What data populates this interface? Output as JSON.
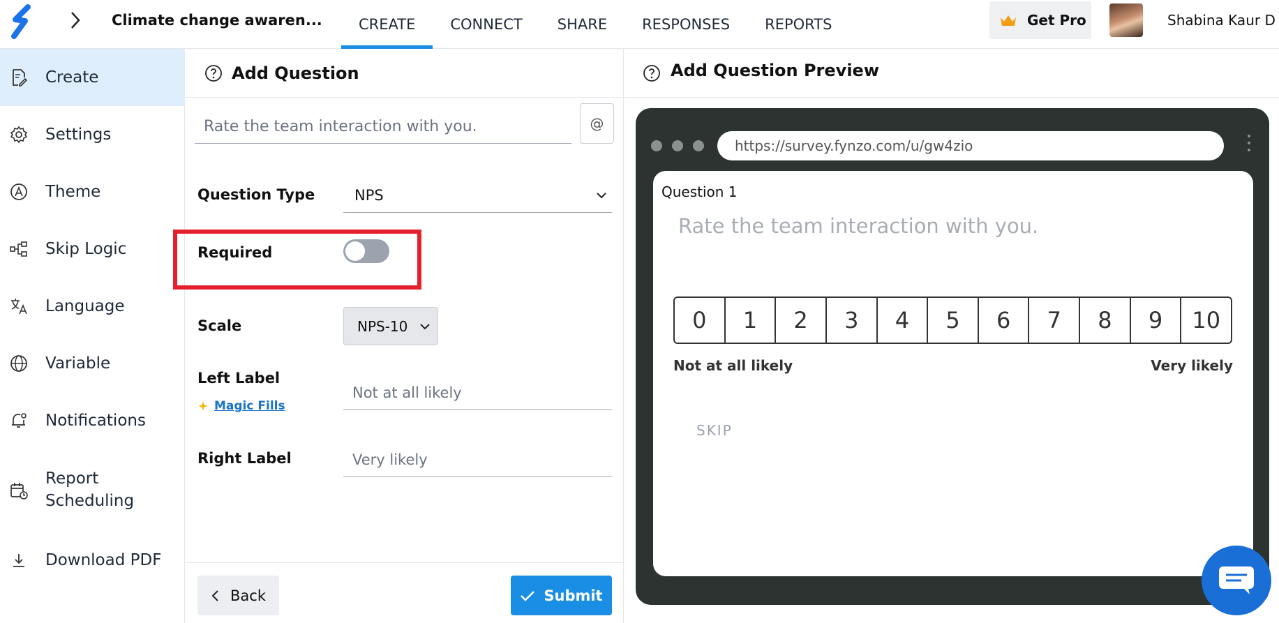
{
  "header": {
    "survey_title": "Climate change awaren...",
    "tabs": [
      {
        "label": "CREATE",
        "active": true
      },
      {
        "label": "CONNECT",
        "active": false
      },
      {
        "label": "SHARE",
        "active": false
      },
      {
        "label": "RESPONSES",
        "active": false
      },
      {
        "label": "REPORTS",
        "active": false
      }
    ],
    "get_pro_label": "Get Pro",
    "user_name": "Shabina Kaur D"
  },
  "sidebar": {
    "items": [
      {
        "label": "Create",
        "icon": "edit-document-icon",
        "active": true
      },
      {
        "label": "Settings",
        "icon": "gear-icon"
      },
      {
        "label": "Theme",
        "icon": "palette-icon"
      },
      {
        "label": "Skip Logic",
        "icon": "flow-icon"
      },
      {
        "label": "Language",
        "icon": "translate-icon"
      },
      {
        "label": "Variable",
        "icon": "globe-icon"
      },
      {
        "label": "Notifications",
        "icon": "bell-icon"
      },
      {
        "label": "Report Scheduling",
        "icon": "calendar-clock-icon"
      },
      {
        "label": "Download PDF",
        "icon": "download-icon"
      }
    ]
  },
  "editor": {
    "title": "Add Question",
    "question_placeholder": "Rate the team interaction with you.",
    "at_label": "@",
    "question_type_label": "Question Type",
    "question_type_value": "NPS",
    "required_label": "Required",
    "required_on": false,
    "scale_label": "Scale",
    "scale_value": "NPS-10",
    "left_label": "Left Label",
    "magic_fills": "Magic Fills",
    "left_label_placeholder": "Not at all likely",
    "right_label": "Right Label",
    "right_label_placeholder": "Very likely",
    "back_label": "Back",
    "submit_label": "Submit"
  },
  "preview": {
    "title": "Add Question Preview",
    "url": "https://survey.fynzo.com/u/gw4zio",
    "question_number": "Question 1",
    "question_text": "Rate the team interaction with you.",
    "scale": [
      "0",
      "1",
      "2",
      "3",
      "4",
      "5",
      "6",
      "7",
      "8",
      "9",
      "10"
    ],
    "left_text": "Not at all likely",
    "right_text": "Very likely",
    "skip_label": "SKIP"
  },
  "colors": {
    "accent": "#1a8ee5",
    "highlight": "#e5202e",
    "sidebar_active": "#dfeefd",
    "preview_frame": "#2c3330"
  }
}
